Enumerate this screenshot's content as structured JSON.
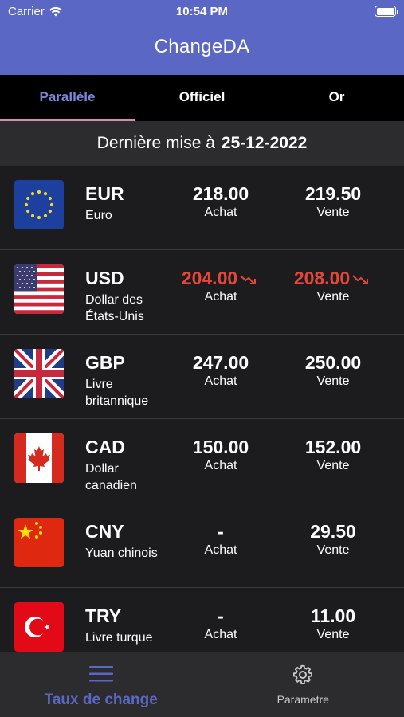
{
  "status_bar": {
    "carrier": "Carrier",
    "time": "10:54 PM"
  },
  "app_title": "ChangeDA",
  "tabs": [
    {
      "label": "Parallèle",
      "active": true
    },
    {
      "label": "Officiel",
      "active": false
    },
    {
      "label": "Or",
      "active": false
    }
  ],
  "update": {
    "label": "Dernière mise à",
    "date": "25-12-2022"
  },
  "rates": [
    {
      "code": "EUR",
      "name": "Euro",
      "flag": "eu-flag-icon",
      "buy": "218.00",
      "buy_label": "Achat",
      "sell": "219.50",
      "sell_label": "Vente",
      "trend": "none"
    },
    {
      "code": "USD",
      "name": "Dollar des États-Unis",
      "flag": "us-flag-icon",
      "buy": "204.00",
      "buy_label": "Achat",
      "sell": "208.00",
      "sell_label": "Vente",
      "trend": "down"
    },
    {
      "code": "GBP",
      "name": "Livre britannique",
      "flag": "uk-flag-icon",
      "buy": "247.00",
      "buy_label": "Achat",
      "sell": "250.00",
      "sell_label": "Vente",
      "trend": "none"
    },
    {
      "code": "CAD",
      "name": "Dollar canadien",
      "flag": "ca-flag-icon",
      "buy": "150.00",
      "buy_label": "Achat",
      "sell": "152.00",
      "sell_label": "Vente",
      "trend": "none"
    },
    {
      "code": "CNY",
      "name": "Yuan chinois",
      "flag": "cn-flag-icon",
      "buy": "-",
      "buy_label": "Achat",
      "sell": "29.50",
      "sell_label": "Vente",
      "trend": "none"
    },
    {
      "code": "TRY",
      "name": "Livre turque",
      "flag": "tr-flag-icon",
      "buy": "-",
      "buy_label": "Achat",
      "sell": "11.00",
      "sell_label": "Vente",
      "trend": "none"
    }
  ],
  "tab_bar": [
    {
      "label": "Taux de change",
      "icon": "menu-icon",
      "active": true
    },
    {
      "label": "Parametre",
      "icon": "gear-icon",
      "active": false
    }
  ],
  "colors": {
    "accent": "#5b67c4",
    "tab_indicator": "#d98ab0",
    "down": "#e5463a"
  }
}
